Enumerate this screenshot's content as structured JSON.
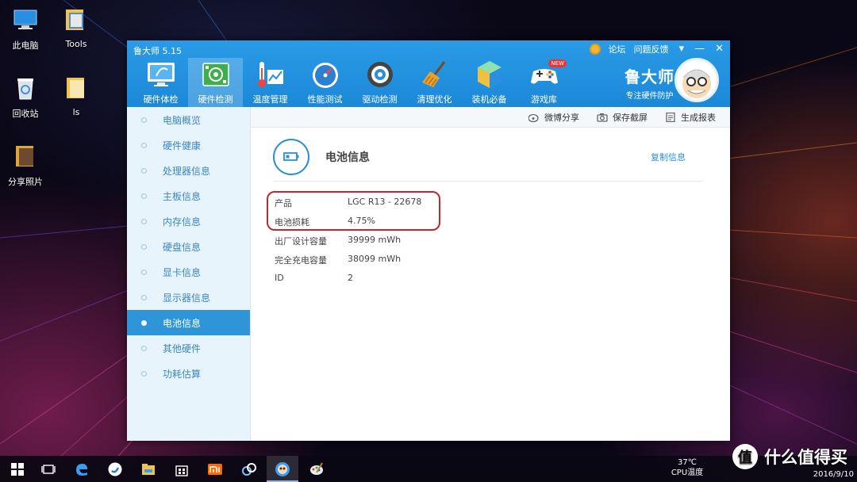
{
  "desktop": {
    "icons": [
      {
        "label": "此电脑",
        "icon": "computer-icon"
      },
      {
        "label": "Tools",
        "icon": "folder-icon"
      },
      {
        "label": "回收站",
        "icon": "recycle-bin-icon"
      },
      {
        "label": "ls",
        "icon": "folder-icon"
      },
      {
        "label": "分享照片",
        "icon": "folder-icon"
      }
    ]
  },
  "window": {
    "title": "鲁大师 5.15",
    "top_links": [
      "论坛",
      "问题反馈"
    ],
    "window_buttons": {
      "menu": "▾",
      "minimize": "—",
      "close": "✕"
    },
    "toolbar": [
      {
        "label": "硬件体检",
        "icon": "monitor-icon"
      },
      {
        "label": "硬件检测",
        "icon": "circuit-board-icon"
      },
      {
        "label": "温度管理",
        "icon": "thermometer-icon"
      },
      {
        "label": "性能测试",
        "icon": "speedometer-icon"
      },
      {
        "label": "驱动检测",
        "icon": "gear-icon"
      },
      {
        "label": "清理优化",
        "icon": "broom-icon"
      },
      {
        "label": "装机必备",
        "icon": "cube-icon"
      },
      {
        "label": "游戏库",
        "icon": "gamepad-icon",
        "badge": "NEW"
      }
    ],
    "active_tool": "硬件检测",
    "brand": {
      "name": "鲁大师",
      "slogan": "专注硬件防护"
    }
  },
  "sidebar": {
    "items": [
      {
        "label": "电脑概览"
      },
      {
        "label": "硬件健康"
      },
      {
        "label": "处理器信息"
      },
      {
        "label": "主板信息"
      },
      {
        "label": "内存信息"
      },
      {
        "label": "硬盘信息"
      },
      {
        "label": "显卡信息"
      },
      {
        "label": "显示器信息"
      },
      {
        "label": "电池信息"
      },
      {
        "label": "其他硬件"
      },
      {
        "label": "功耗估算"
      }
    ],
    "active": "电池信息"
  },
  "actions": [
    {
      "label": "微博分享",
      "icon": "weibo-icon"
    },
    {
      "label": "保存截屏",
      "icon": "camera-icon"
    },
    {
      "label": "生成报表",
      "icon": "report-icon"
    }
  ],
  "panel": {
    "title": "电池信息",
    "copy_label": "复制信息",
    "rows": [
      {
        "key": "产品",
        "value": "LGC R13 - 22678"
      },
      {
        "key": "电池损耗",
        "value": "4.75%"
      },
      {
        "key": "出厂设计容量",
        "value": "39999 mWh"
      },
      {
        "key": "完全充电容量",
        "value": "38099 mWh"
      },
      {
        "key": "ID",
        "value": "2"
      }
    ]
  },
  "taskbar": {
    "temperature": "37℃",
    "temperature_label": "CPU温度",
    "date": "2016/9/10"
  },
  "watermark": {
    "badge": "值",
    "text": "什么值得买"
  },
  "colors": {
    "accent": "#1b88d8",
    "sidebar_active": "#2f95d9",
    "highlight": "#c0282e"
  }
}
